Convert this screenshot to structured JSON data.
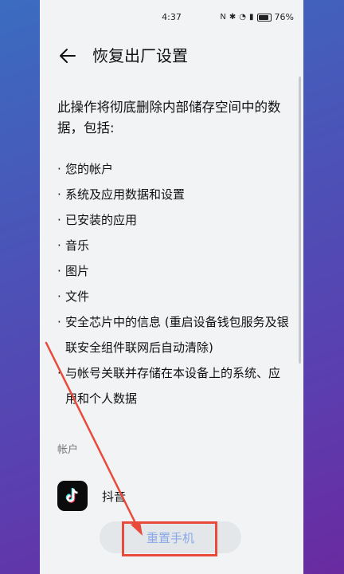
{
  "status_bar": {
    "time": "4:37",
    "battery": "76%"
  },
  "header": {
    "title": "恢复出厂设置"
  },
  "description": "此操作将彻底删除内部储存空间中的数据，包括:",
  "items": [
    "您的帐户",
    "系统及应用数据和设置",
    "已安装的应用",
    "音乐",
    "图片",
    "文件",
    "安全芯片中的信息 (重启设备钱包服务及银联安全组件联网后自动清除)",
    "与帐号关联并存储在本设备上的系统、应用和个人数据"
  ],
  "accounts_section": {
    "label": "帐户",
    "account_name": "抖音"
  },
  "reset_button": {
    "label": "重置手机"
  },
  "colors": {
    "accent": "#8aa8e8",
    "annotation": "#e84a3c"
  }
}
